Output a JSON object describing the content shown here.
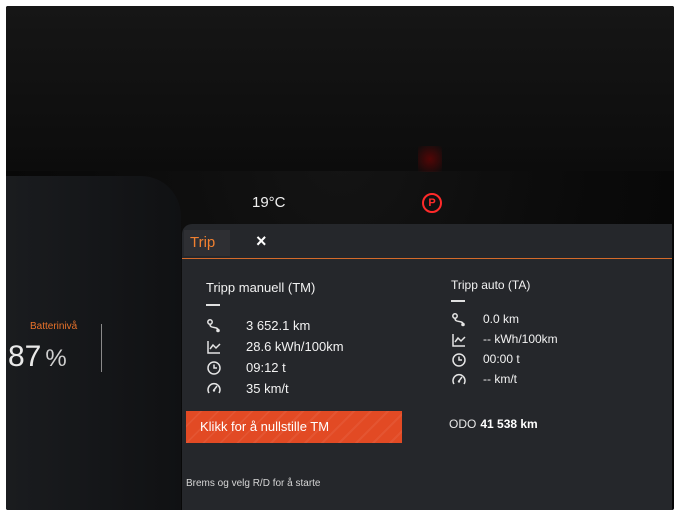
{
  "status": {
    "temperature": "19°C",
    "parking_brake_symbol": "P"
  },
  "battery": {
    "label": "Batterinivå",
    "value": "87",
    "unit": "%"
  },
  "trip_panel": {
    "tab_label": "Trip",
    "close_symbol": "×",
    "manual": {
      "title": "Tripp manuell (TM)",
      "rows": [
        {
          "icon": "distance-icon",
          "value": "3 652.1 km"
        },
        {
          "icon": "consumption-chart-icon",
          "value": "28.6 kWh/100km"
        },
        {
          "icon": "clock-icon",
          "value": "09:12 t"
        },
        {
          "icon": "speedometer-icon",
          "value": "35 km/t"
        }
      ],
      "reset_label": "Klikk for å nullstille TM"
    },
    "auto": {
      "title": "Tripp auto (TA)",
      "rows": [
        {
          "icon": "distance-icon",
          "value": "0.0 km"
        },
        {
          "icon": "consumption-chart-icon",
          "value": "-- kWh/100km"
        },
        {
          "icon": "clock-icon",
          "value": "00:00 t"
        },
        {
          "icon": "speedometer-icon",
          "value": "-- km/t"
        }
      ]
    },
    "odo": {
      "label": "ODO",
      "value": "41 538 km"
    },
    "hint": "Brems og velg R/D for å starte"
  },
  "colors": {
    "accent": "#f08030",
    "reset_button": "#e24a24",
    "warning": "#ff2a2a",
    "panel_bg": "#25272b"
  }
}
